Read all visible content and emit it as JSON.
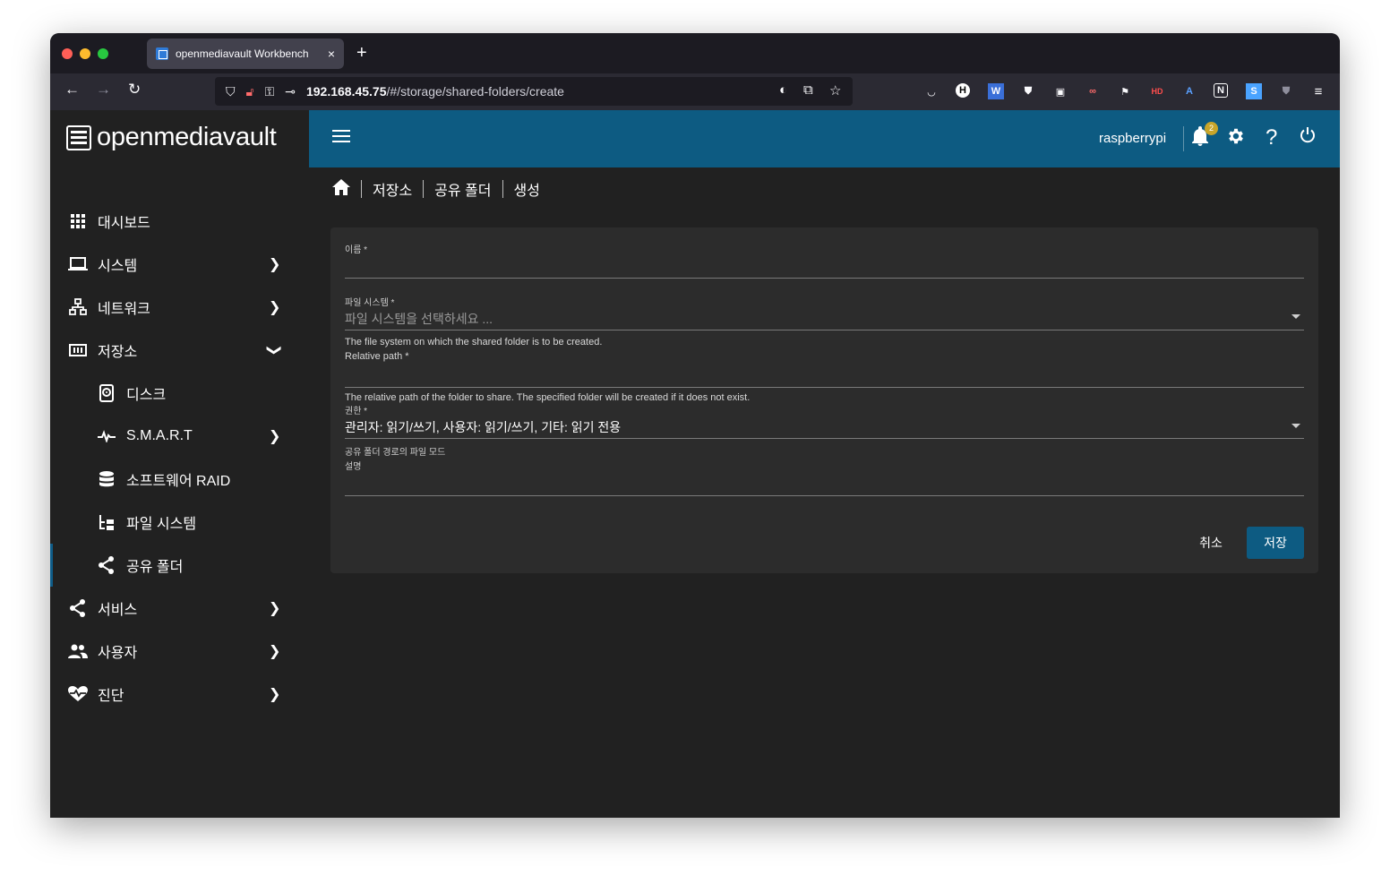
{
  "browser": {
    "tab_title": "openmediavault Workbench",
    "tab_close": "×",
    "new_tab": "+",
    "url_host": "192.168.45.75",
    "url_path": "/#/storage/shared-folders/create"
  },
  "app": {
    "logo_text": "openmediavault",
    "username": "raspberrypi",
    "notification_count": "2"
  },
  "sidebar": {
    "items": [
      {
        "label": "대시보드"
      },
      {
        "label": "시스템"
      },
      {
        "label": "네트워크"
      },
      {
        "label": "저장소"
      },
      {
        "label": "디스크"
      },
      {
        "label": "S.M.A.R.T"
      },
      {
        "label": "소프트웨어 RAID"
      },
      {
        "label": "파일 시스템"
      },
      {
        "label": "공유 폴더"
      },
      {
        "label": "서비스"
      },
      {
        "label": "사용자"
      },
      {
        "label": "진단"
      }
    ]
  },
  "breadcrumb": {
    "items": [
      "저장소",
      "공유 폴더",
      "생성"
    ]
  },
  "form": {
    "name_label": "이름 *",
    "fs_label": "파일 시스템 *",
    "fs_placeholder": "파일 시스템을 선택하세요 ...",
    "fs_hint": "The file system on which the shared folder is to be created.",
    "relpath_label": "Relative path *",
    "relpath_hint": "The relative path of the folder to share. The specified folder will be created if it does not exist.",
    "perm_label": "권한 *",
    "perm_value": "관리자: 읽기/쓰기, 사용자: 읽기/쓰기, 기타: 읽기 전용",
    "perm_hint": "공유 폴더 경로의 파일 모드",
    "desc_label": "설명",
    "cancel_label": "취소",
    "save_label": "저장"
  },
  "colors": {
    "accent": "#0d5b82",
    "background": "#212121",
    "card": "#2c2c2c"
  }
}
